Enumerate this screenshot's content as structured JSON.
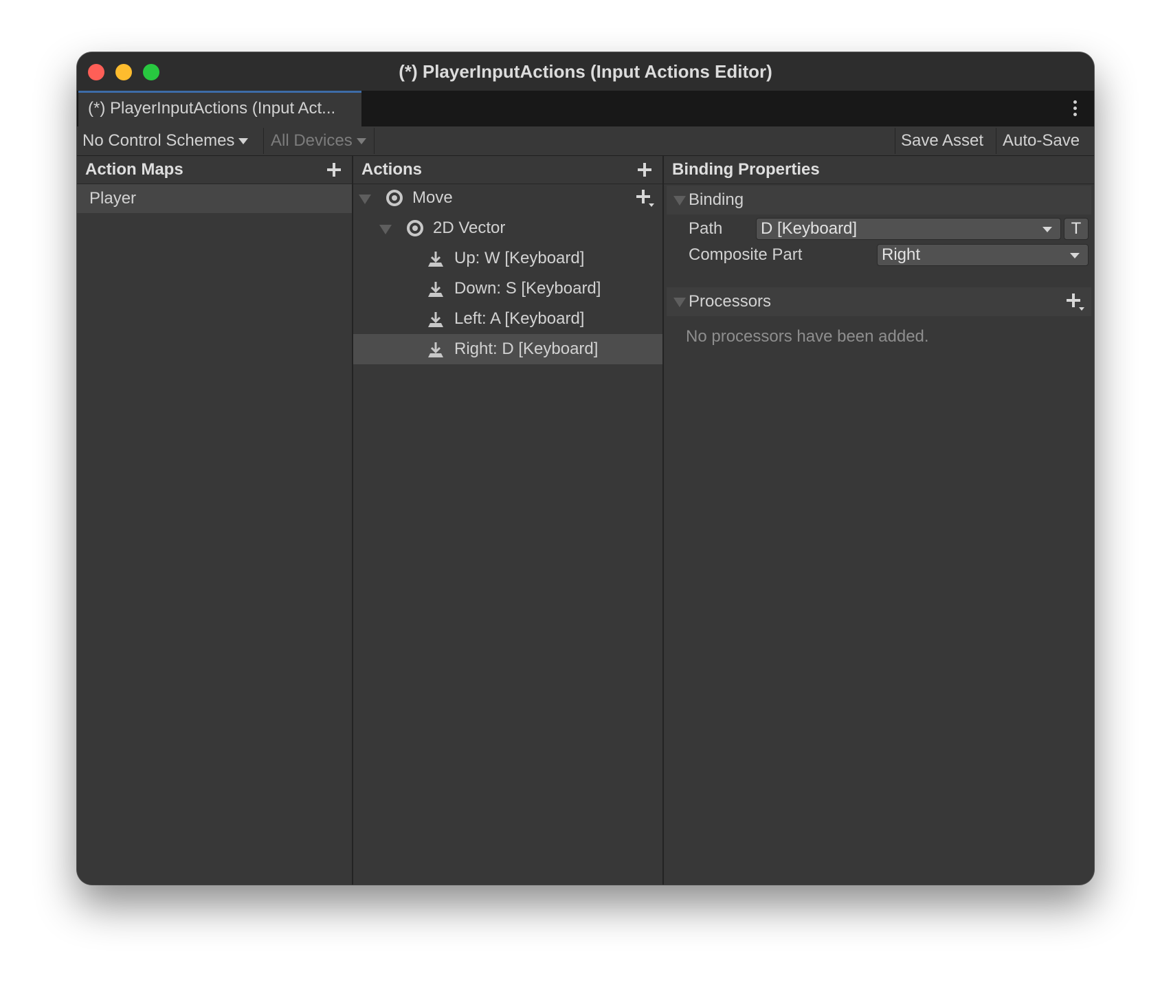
{
  "window": {
    "title": "(*) PlayerInputActions (Input Actions Editor)",
    "tab_label": "(*) PlayerInputActions (Input Act..."
  },
  "toolbar": {
    "control_schemes": "No Control Schemes",
    "devices": "All Devices",
    "save_asset": "Save Asset",
    "auto_save": "Auto-Save"
  },
  "action_maps": {
    "header": "Action Maps",
    "items": [
      {
        "label": "Player",
        "selected": true
      }
    ]
  },
  "actions": {
    "header": "Actions",
    "tree": [
      {
        "label": "Move",
        "icon": "action-icon",
        "level": 0
      },
      {
        "label": "2D Vector",
        "icon": "composite-icon",
        "level": 1
      },
      {
        "label": "Up: W [Keyboard]",
        "icon": "binding-icon",
        "level": 2
      },
      {
        "label": "Down: S [Keyboard]",
        "icon": "binding-icon",
        "level": 2
      },
      {
        "label": "Left: A [Keyboard]",
        "icon": "binding-icon",
        "level": 2
      },
      {
        "label": "Right: D [Keyboard]",
        "icon": "binding-icon",
        "level": 2,
        "selected": true
      }
    ]
  },
  "binding_properties": {
    "header": "Binding Properties",
    "binding_section": "Binding",
    "path_label": "Path",
    "path_value": "D [Keyboard]",
    "t_button": "T",
    "composite_part_label": "Composite Part",
    "composite_part_value": "Right",
    "processors_section": "Processors",
    "processors_empty": "No processors have been added."
  },
  "colors": {
    "window_bg": "#383838",
    "tab_accent": "#3d6ca8",
    "selection": "#4d4d4d"
  }
}
